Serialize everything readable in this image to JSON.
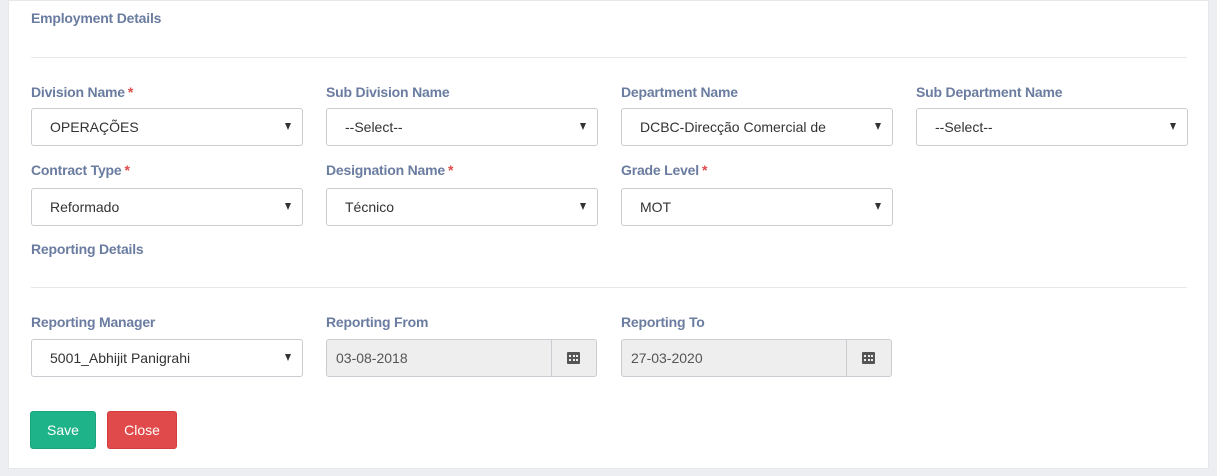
{
  "employment": {
    "title": "Employment Details",
    "division": {
      "label": "Division Name",
      "required": "*",
      "value": "OPERAÇÕES"
    },
    "sub_division": {
      "label": "Sub Division Name",
      "value": "--Select--"
    },
    "department": {
      "label": "Department Name",
      "value": "DCBC-Direcção Comercial de"
    },
    "sub_department": {
      "label": "Sub Department Name",
      "value": "--Select--"
    },
    "contract_type": {
      "label": "Contract Type",
      "required": "*",
      "value": "Reformado"
    },
    "designation": {
      "label": "Designation Name",
      "required": "*",
      "value": "Técnico"
    },
    "grade_level": {
      "label": "Grade Level",
      "required": "*",
      "value": "MOT"
    }
  },
  "reporting": {
    "title": "Reporting Details",
    "manager": {
      "label": "Reporting Manager",
      "value": "5001_Abhijit Panigrahi"
    },
    "from": {
      "label": "Reporting From",
      "value": "03-08-2018"
    },
    "to": {
      "label": "Reporting To",
      "value": "27-03-2020"
    }
  },
  "actions": {
    "save_label": "Save",
    "close_label": "Close"
  },
  "icons": {
    "dropdown": "caret-down-icon",
    "date": "calendar-icon"
  },
  "colors": {
    "label": "#6a7ca0",
    "required": "#e04b4b",
    "save": "#1fb38a",
    "close": "#e04a4a"
  }
}
